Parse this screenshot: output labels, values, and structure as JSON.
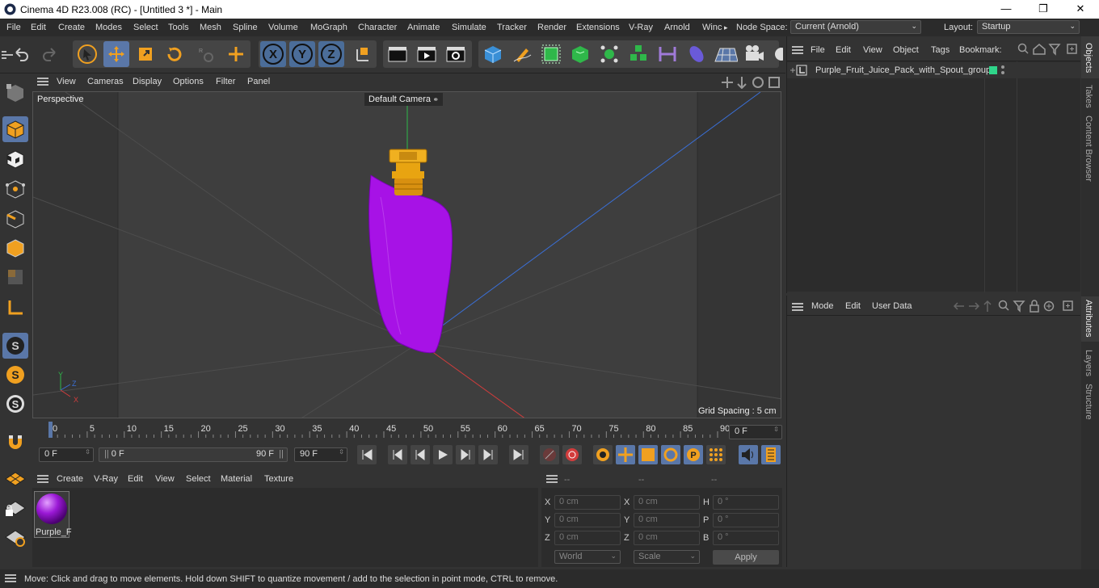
{
  "window": {
    "title": "Cinema 4D R23.008 (RC) - [Untitled 3 *] - Main",
    "minimize": "—",
    "restore": "❐",
    "close": "✕"
  },
  "menu": {
    "items": [
      "File",
      "Edit",
      "Create",
      "Modes",
      "Select",
      "Tools",
      "Mesh",
      "Spline",
      "Volume",
      "MoGraph",
      "Character",
      "Animate",
      "Simulate",
      "Tracker",
      "Render",
      "Extensions",
      "V-Ray",
      "Arnold",
      "Winc"
    ],
    "overflow": "▸",
    "node_space_label": "Node Space:",
    "node_space_value": "Current (Arnold)",
    "layout_label": "Layout:",
    "layout_value": "Startup"
  },
  "viewport": {
    "menu": [
      "View",
      "Cameras",
      "Display",
      "Options",
      "Filter",
      "Panel"
    ],
    "label": "Perspective",
    "camera": "Default Camera",
    "grid_spacing": "Grid Spacing : 5 cm",
    "axis": {
      "y": "Y",
      "z": "Z",
      "x": "X"
    }
  },
  "timeline": {
    "ticks": [
      "0",
      "5",
      "10",
      "15",
      "20",
      "25",
      "30",
      "35",
      "40",
      "45",
      "50",
      "55",
      "60",
      "65",
      "70",
      "75",
      "80",
      "85",
      "90"
    ],
    "current_frame": "0 F",
    "start": "0 F",
    "range_start": "0 F",
    "range_end": "90 F",
    "end": "90 F"
  },
  "material_manager": {
    "menu": [
      "Create",
      "V-Ray",
      "Edit",
      "View",
      "Select",
      "Material",
      "Texture"
    ],
    "material_name": "Purple_F",
    "material_color": "#9b19d6"
  },
  "coordinates": {
    "header": [
      "--",
      "--",
      "--"
    ],
    "rows": [
      {
        "a": "X",
        "av": "0 cm",
        "b": "X",
        "bv": "0 cm",
        "c": "H",
        "cv": "0 °"
      },
      {
        "a": "Y",
        "av": "0 cm",
        "b": "Y",
        "bv": "0 cm",
        "c": "P",
        "cv": "0 °"
      },
      {
        "a": "Z",
        "av": "0 cm",
        "b": "Z",
        "bv": "0 cm",
        "c": "B",
        "cv": "0 °"
      }
    ],
    "space": "World",
    "mode": "Scale",
    "apply": "Apply"
  },
  "objects": {
    "menu": [
      "File",
      "Edit",
      "View",
      "Object",
      "Tags",
      "Bookmark:"
    ],
    "items": [
      {
        "name": "Purple_Fruit_Juice_Pack_with_Spout_group"
      }
    ]
  },
  "attributes": {
    "menu": [
      "Mode",
      "Edit",
      "User Data"
    ]
  },
  "side_tabs": [
    "Objects",
    "Takes",
    "Content Browser",
    "Attributes",
    "Layers",
    "Structure"
  ],
  "status": "Move: Click and drag to move elements. Hold down SHIFT to quantize movement / add to the selection in point mode, CTRL to remove.",
  "colors": {
    "accent": "#5a77a8",
    "pack": "#a712e6",
    "spout": "#e8a411",
    "x_axis": "#d23c3c",
    "y_axis": "#2fb84a",
    "z_axis": "#3a6fd6"
  }
}
